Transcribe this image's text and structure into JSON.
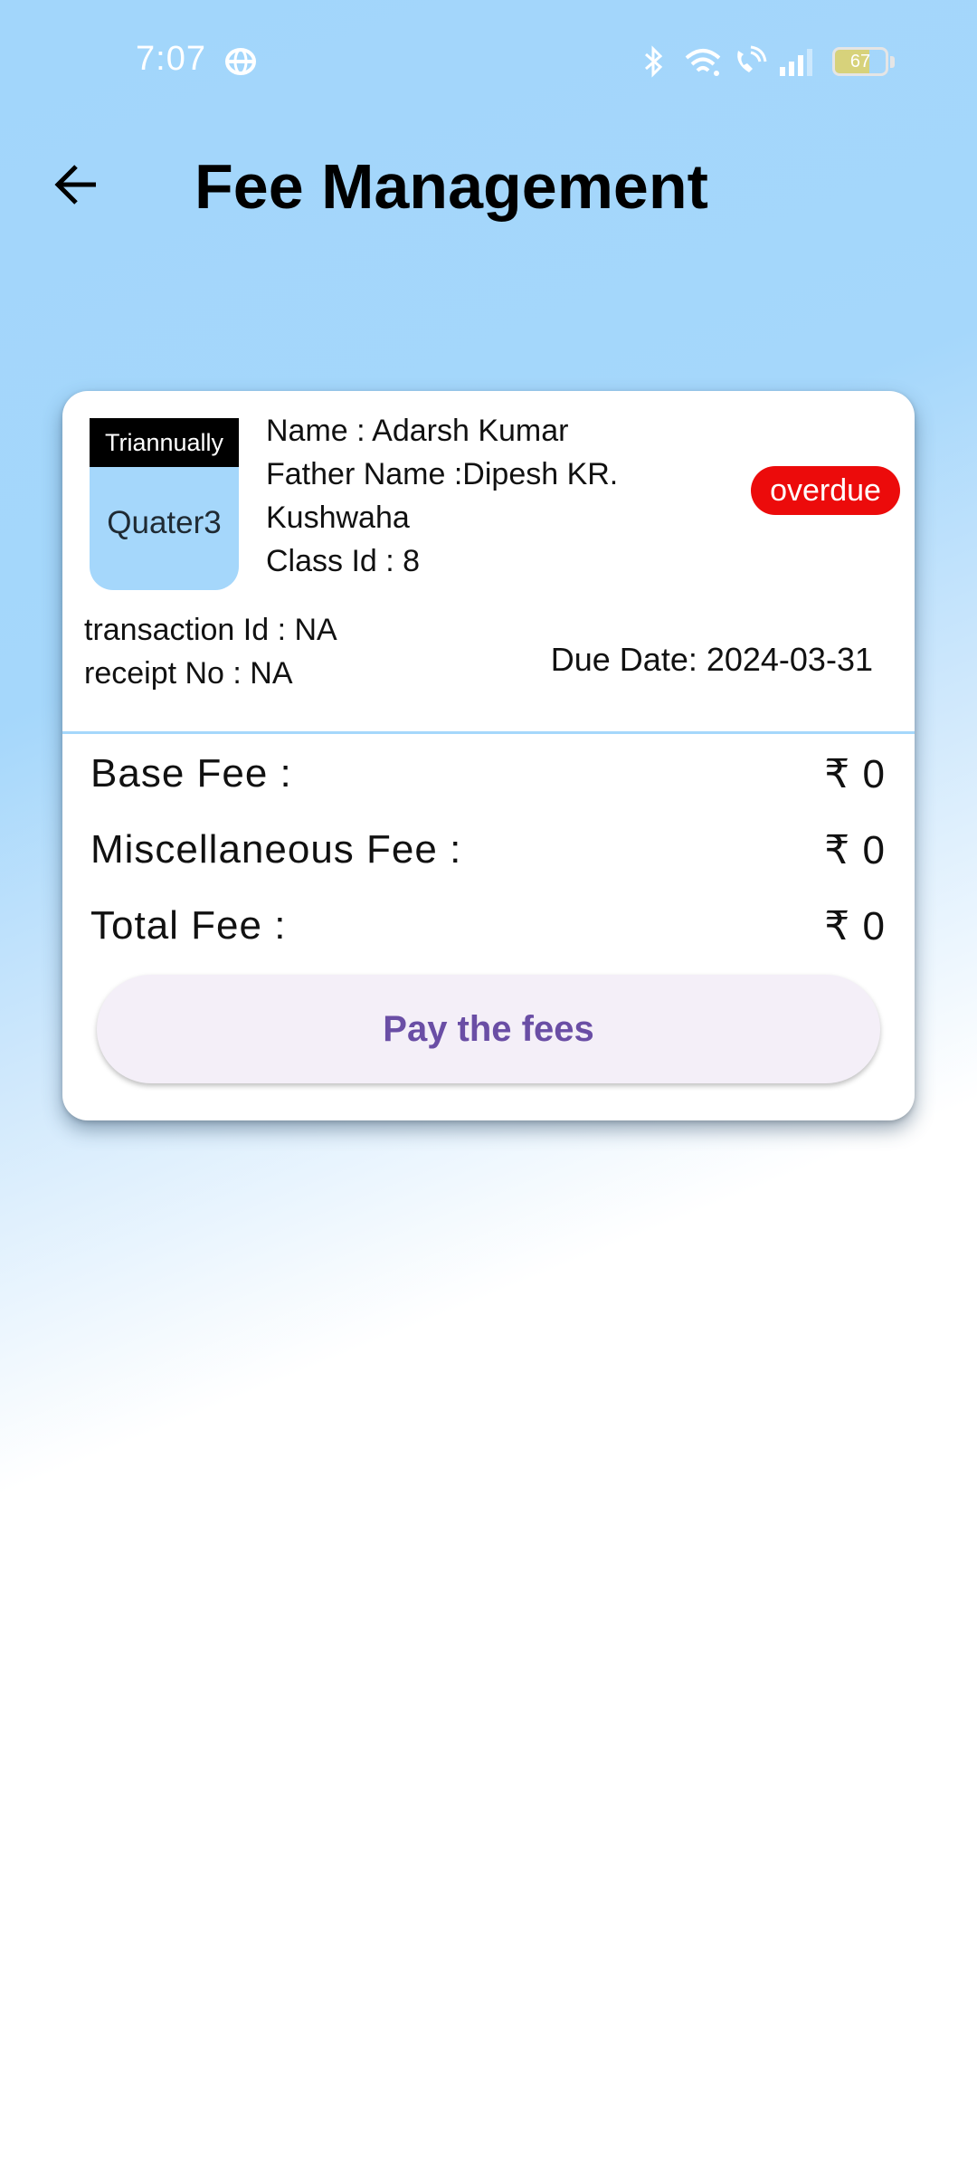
{
  "status_bar": {
    "time": "7:07",
    "battery": "67",
    "battery_level": 0.67,
    "icons": [
      "hotspot-icon",
      "bluetooth-icon",
      "wifi-icon",
      "wifi-calling-icon",
      "signal-icon",
      "battery-icon"
    ]
  },
  "app_bar": {
    "title": "Fee Management",
    "back_icon": "arrow-left-icon"
  },
  "fee_card": {
    "plan_type": "Triannually",
    "quarter": "Quater3",
    "name": "Name : Adarsh Kumar",
    "father_name_line1": "Father Name :Dipesh KR.",
    "father_name_line2": "Kushwaha",
    "class_id": "Class Id : 8",
    "status": "overdue",
    "transaction_id": "transaction Id : NA",
    "receipt_no": "receipt No : NA",
    "due_date": "Due Date: 2024-03-31",
    "fees": [
      {
        "label": "Base Fee :",
        "value": "₹ 0"
      },
      {
        "label": "Miscellaneous Fee :",
        "value": "₹ 0"
      },
      {
        "label": "Total Fee :",
        "value": "₹ 0"
      }
    ],
    "pay_button": "Pay the fees"
  },
  "colors": {
    "background_top": "#a5d7fb",
    "overdue": "#ec0b0b",
    "pay_button_text": "#6a4ea5",
    "pay_button_bg": "#f4eff8"
  }
}
